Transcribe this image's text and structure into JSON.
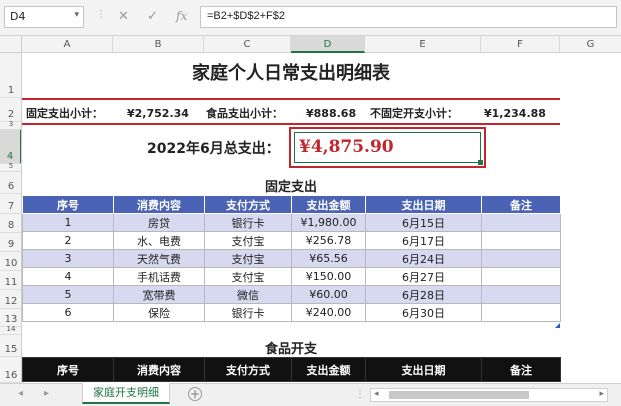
{
  "formula_bar": {
    "name_box": "D4",
    "cancel_icon": "✕",
    "enter_icon": "✓",
    "fx_label": "fx",
    "formula": "=B2+$D$2+F$2"
  },
  "columns": [
    "A",
    "B",
    "C",
    "D",
    "E",
    "F",
    "G"
  ],
  "selected_column": "D",
  "rows": [
    "1",
    "2",
    "3",
    "4",
    "5",
    "6",
    "7",
    "8",
    "9",
    "10",
    "11",
    "12",
    "13",
    "14",
    "15",
    "16"
  ],
  "selected_row": "4",
  "sheet": {
    "title": "家庭个人日常支出明细表",
    "summary": {
      "fixed_label": "固定支出小计：",
      "fixed_value": "¥2,752.34",
      "food_label": "食品支出小计：",
      "food_value": "¥888.68",
      "variable_label": "不固定开支小计：",
      "variable_value": "¥1,234.88"
    },
    "total_label": "2022年6月总支出：",
    "total_value": "¥4,875.90",
    "fixed_section": {
      "title": "固定支出",
      "headers": [
        "序号",
        "消费内容",
        "支付方式",
        "支出金额",
        "支出日期",
        "备注"
      ],
      "rows": [
        [
          "1",
          "房贷",
          "银行卡",
          "¥1,980.00",
          "6月15日",
          ""
        ],
        [
          "2",
          "水、电费",
          "支付宝",
          "¥256.78",
          "6月17日",
          ""
        ],
        [
          "3",
          "天然气费",
          "支付宝",
          "¥65.56",
          "6月24日",
          ""
        ],
        [
          "4",
          "手机话费",
          "支付宝",
          "¥150.00",
          "6月27日",
          ""
        ],
        [
          "5",
          "宽带费",
          "微信",
          "¥60.00",
          "6月28日",
          ""
        ],
        [
          "6",
          "保险",
          "银行卡",
          "¥240.00",
          "6月30日",
          ""
        ]
      ]
    },
    "food_section": {
      "title": "食品开支",
      "headers": [
        "序号",
        "消费内容",
        "支付方式",
        "支出金额",
        "支出日期",
        "备注"
      ]
    }
  },
  "sheet_tabs": {
    "active": "家庭开支明细",
    "add_symbol": "+"
  },
  "nav": {
    "left": "◂",
    "right": "▸",
    "more": "⋮"
  },
  "colors": {
    "accent_green": "#217346",
    "header_blue": "#4a63b5",
    "band_blue": "#d6d9f0",
    "total_red": "#c0272d"
  }
}
